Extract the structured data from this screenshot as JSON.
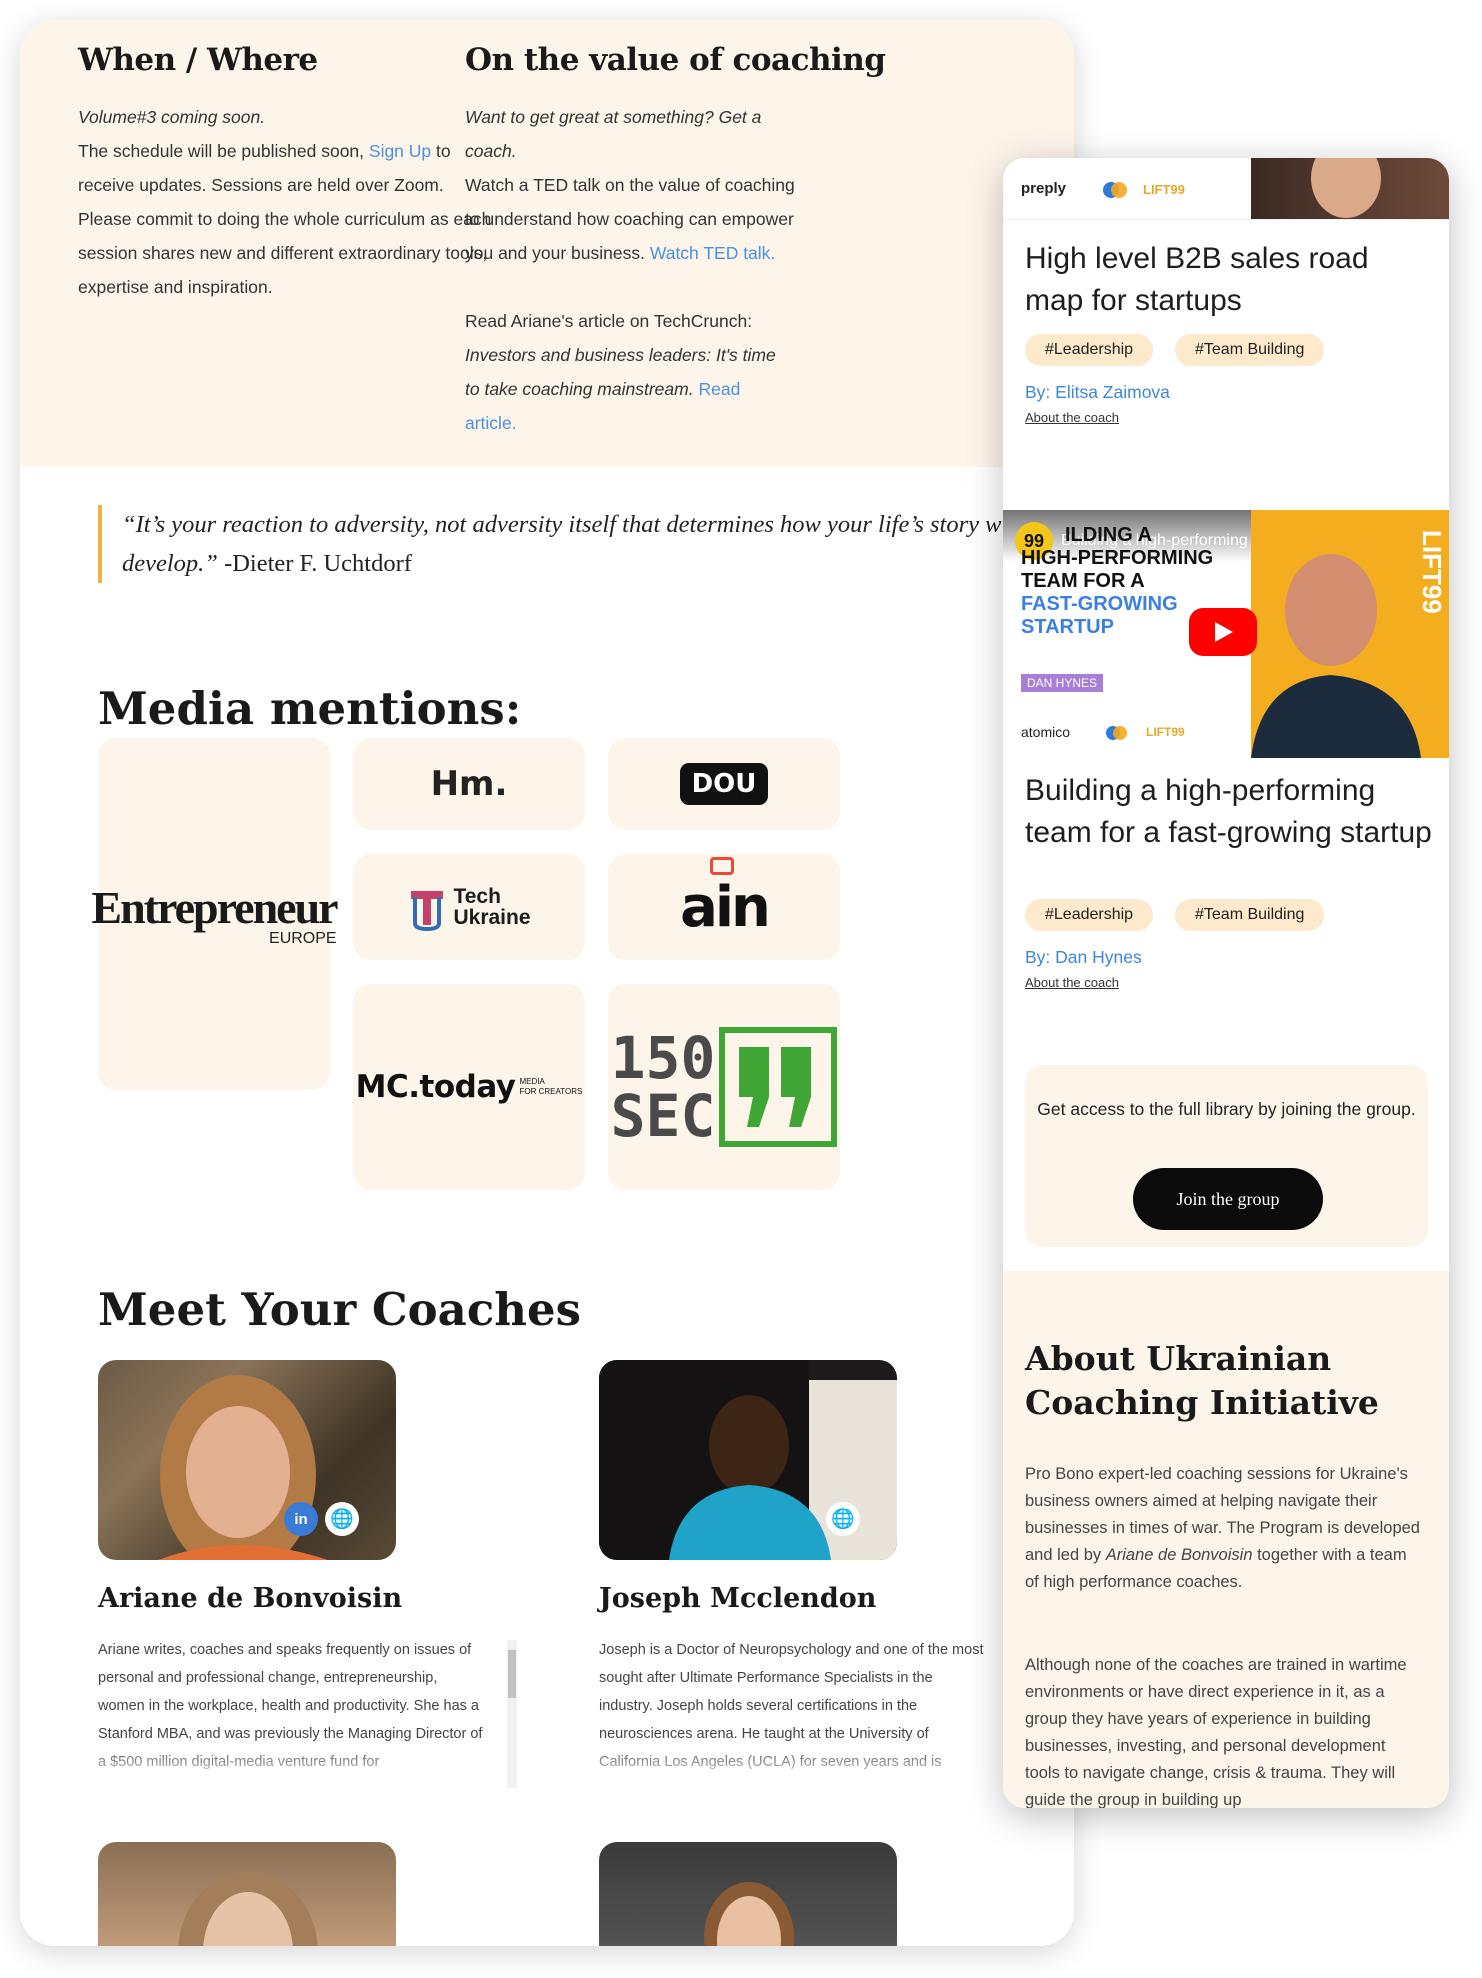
{
  "when_where": {
    "heading": "When / Where",
    "coming": "Volume#3 coming soon.",
    "text_1": "The schedule will be published soon, ",
    "link": "Sign Up",
    "text_2": " to receive updates. Sessions are held over Zoom. Please commit to doing the whole curriculum as each session shares new and different extraordinary tools, expertise and inspiration."
  },
  "value": {
    "heading": "On the value of coaching",
    "intro": "Want to get great at something? Get a coach.",
    "text_1": "Watch a TED talk on the value of coaching to understand how coaching can empower you and your business. ",
    "link_1": "Watch TED talk.",
    "text_2": "Read Ariane's article on TechCrunch: ",
    "article": "Investors and business leaders: It's time to take coaching mainstream.",
    "link_2": "Read article."
  },
  "quote": {
    "text": "“It’s your reaction to adversity, not adversity itself that determines how your life’s story will develop.”",
    "author": " -Dieter F. Uchtdorf"
  },
  "media": {
    "heading": "Media mentions:",
    "entrepreneur": "Entrepreneur",
    "entrepreneur_sub": "EUROPE",
    "hm": "Hm.",
    "dou": "DOU",
    "tech_ukraine_1": "Tech",
    "tech_ukraine_2": "Ukraine",
    "ain": "ain",
    "mctoday": "MC.today",
    "mctoday_sub_1": "MEDIA",
    "mctoday_sub_2": "FOR CREATORS",
    "sec_1": "150",
    "sec_2": "SEC"
  },
  "coaches": {
    "heading": "Meet Your Coaches",
    "list": [
      {
        "name": "Ariane de Bonvoisin",
        "bio": "Ariane writes, coaches and speaks frequently on issues of personal and professional change, entrepreneurship, women in the workplace, health and productivity. She has a Stanford MBA, and was previously the Managing Director of a $500 million digital-media venture fund for"
      },
      {
        "name": "Joseph Mcclendon",
        "bio": "Joseph is a Doctor of Neuropsychology and one of the most sought after Ultimate Performance Specialists in the industry. Joseph holds several certifications in the neurosciences arena. He taught at the University of California Los Angeles (UCLA) for seven years and is"
      }
    ]
  },
  "mobile": {
    "card_1": {
      "thumb_brand_1": "preply",
      "thumb_brand_2": "LIFT99",
      "title": "High level B2B sales road map for startups",
      "tags": [
        "#Leadership",
        "#Team Building"
      ],
      "by": "By: Elitsa Zaimova",
      "about": "About the coach"
    },
    "card_2": {
      "video_title": "Building a high-performing team for ...",
      "thumb_heading_1": "ILDING A",
      "thumb_heading_2": "HIGH-PERFORMING",
      "thumb_heading_3": "TEAM FOR A",
      "thumb_heading_4": "FAST-GROWING",
      "thumb_heading_5": "STARTUP",
      "thumb_speaker": "DAN HYNES",
      "thumb_brand_1": "atomico",
      "thumb_brand_2": "LIFT99",
      "thumb_side": "LIFT99",
      "title": "Building a high-performing team for a fast-growing startup",
      "tags": [
        "#Leadership",
        "#Team Building"
      ],
      "by": "By: Dan Hynes",
      "about": "About the coach"
    },
    "access_text": "Get access to the full library by joining the group.",
    "join_button": "Join the group",
    "about_heading": "About Ukrainian Coaching Initiative",
    "about_p1_a": "Pro Bono expert-led coaching sessions for Ukraine's business owners aimed at helping navigate their businesses in times of war. The Program is developed and led by ",
    "about_p1_name": "Ariane de Bonvoisin",
    "about_p1_b": " together with a team of high performance coaches.",
    "about_p2": "Although none of the coaches are trained in wartime environments or have direct experience in it, as a group they have years of experience in building businesses, investing, and personal development tools to navigate change, crisis & trauma. They will guide the group in building up"
  },
  "colors": {
    "cream": "#fdf5ea",
    "link": "#4a90e2",
    "quote_bar": "#f0b23c",
    "tag": "#fde9cc",
    "button": "#0b0b0b"
  }
}
